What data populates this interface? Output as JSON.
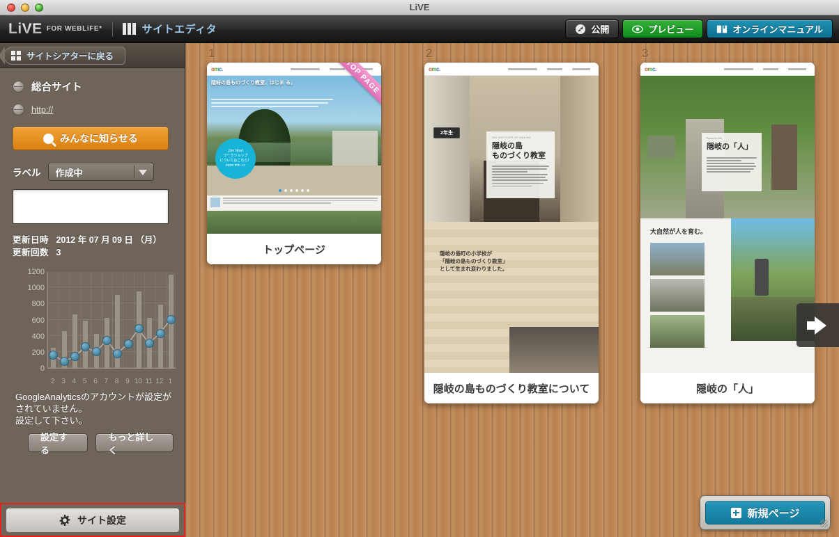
{
  "window": {
    "title": "LiVE"
  },
  "toolbar": {
    "brand_live": "LiVE",
    "brand_sub": "FOR WEBLiFE*",
    "editor_label": "サイトエディタ",
    "publish_label": "公開",
    "preview_label": "プレビュー",
    "manual_label": "オンラインマニュアル"
  },
  "sidebar": {
    "back_label": "サイトシアターに戻る",
    "site_name": "総合サイト",
    "url": "http://",
    "notify_label": "みんなに知らせる",
    "label_caption": "ラベル",
    "label_value": "作成中",
    "label_options": [
      "作成中"
    ],
    "memo_value": "",
    "memo_placeholder": "",
    "updated_key": "更新日時",
    "updated_value": "2012 年 07 月 09 日 （月）",
    "count_key": "更新回数",
    "count_value": "3",
    "ga_note": "GoogleAnalyticsのアカウントが設定がされていません。\n設定して下さい。",
    "ga_note_line1": "GoogleAnalyticsのアカウントが設定が",
    "ga_note_line2": "されていません。",
    "ga_note_line3": "設定して下さい。",
    "ga_setup_label": "設定する",
    "ga_more_label": "もっと詳しく",
    "settings_label": "サイト設定"
  },
  "chart_data": {
    "type": "bar",
    "title": "",
    "xlabel": "",
    "ylabel": "",
    "categories": [
      "2",
      "3",
      "4",
      "5",
      "6",
      "7",
      "8",
      "9",
      "10",
      "11",
      "12",
      "1"
    ],
    "yticks": [
      0,
      200,
      400,
      600,
      800,
      1000,
      1200
    ],
    "ylim": [
      0,
      1200
    ],
    "grid": true,
    "legend": "none",
    "series": [
      {
        "name": "bars",
        "type": "bar",
        "values": [
          250,
          455,
          665,
          585,
          420,
          620,
          910,
          0,
          950,
          620,
          785,
          1160
        ]
      },
      {
        "name": "line",
        "type": "line",
        "values": [
          160,
          80,
          145,
          260,
          200,
          345,
          180,
          300,
          485,
          310,
          430,
          600
        ]
      }
    ]
  },
  "canvas": {
    "next_label": "",
    "new_page_label": "新規ページ",
    "pages": [
      {
        "number": "1",
        "caption": "トップページ",
        "ribbon": "TOP PAGE",
        "hero_title": "隠岐の島ものづくり教室、はじま\nる。",
        "badge_line1": "Join Now!",
        "badge_line2": "ワークショップ",
        "badge_line3": "についてはこちら！",
        "badge_line4": "more info >>"
      },
      {
        "number": "2",
        "caption": "隠岐の島ものづくり教室について",
        "panel_eyebrow": "OKI INSTITUTE OF MAKING",
        "panel_title_line1": "隠岐の島",
        "panel_title_line2": "ものづくり教室",
        "sign_label": "2年生",
        "lower_title_line1": "隠岐の島町の小学校が",
        "lower_title_line2": "「隠岐の島ものづくり教室」",
        "lower_title_line3": "として生まれ変わりました。"
      },
      {
        "number": "3",
        "caption": "隠岐の「人」",
        "panel_eyebrow": "Person in Oki",
        "panel_title": "隠岐の「人」",
        "lower_title": "大自然が人を育む。"
      }
    ]
  }
}
